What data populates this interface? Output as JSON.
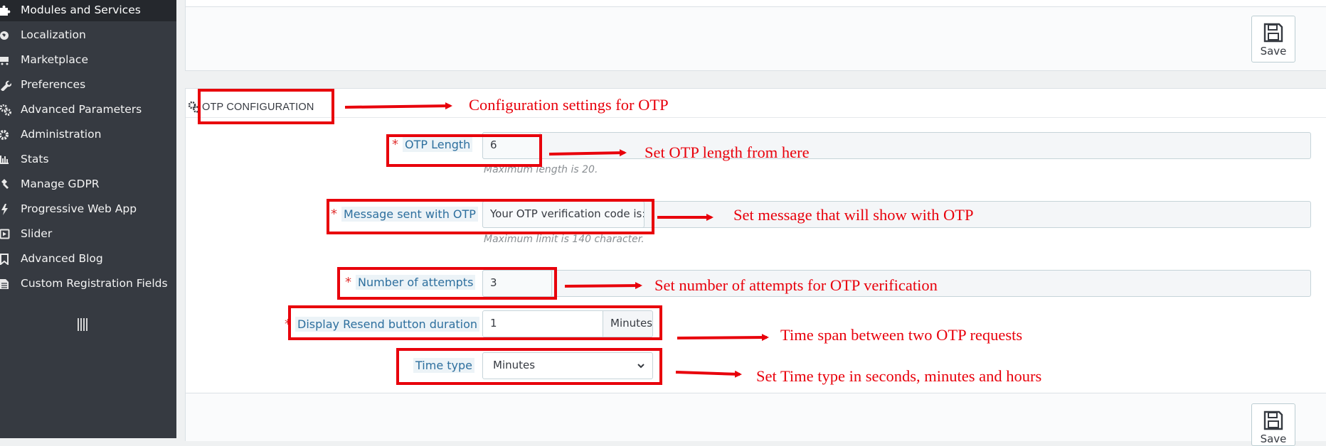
{
  "sidebar": {
    "items": [
      {
        "label": "Modules and Services",
        "icon": "puzzle-icon",
        "active": true
      },
      {
        "label": "Localization",
        "icon": "globe-icon"
      },
      {
        "label": "Marketplace",
        "icon": "cart-icon"
      },
      {
        "label": "Preferences",
        "icon": "wrench-icon"
      },
      {
        "label": "Advanced Parameters",
        "icon": "gears-icon"
      },
      {
        "label": "Administration",
        "icon": "gear-icon"
      },
      {
        "label": "Stats",
        "icon": "bar-chart-icon"
      },
      {
        "label": "Manage GDPR",
        "icon": "gavel-icon"
      },
      {
        "label": "Progressive Web App",
        "icon": "bolt-icon"
      },
      {
        "label": "Slider",
        "icon": "play-square-icon"
      },
      {
        "label": "Advanced Blog",
        "icon": "bookmark-icon"
      },
      {
        "label": "Custom Registration Fields",
        "icon": "file-icon"
      }
    ]
  },
  "toolbar": {
    "save_label": "Save"
  },
  "section": {
    "title": "OTP CONFIGURATION",
    "icon": "gears-icon"
  },
  "form": {
    "otp_length": {
      "label": "OTP Length",
      "value": "6",
      "help": "Maximum length is 20.",
      "required": true
    },
    "message": {
      "label": "Message sent with OTP",
      "value": "Your OTP verification code is:",
      "help": "Maximum limit is 140 character.",
      "required": true
    },
    "attempts": {
      "label": "Number of attempts",
      "value": "3",
      "required": true
    },
    "resend": {
      "label": "Display Resend button duration",
      "value": "1",
      "addon": "Minutes",
      "required": true
    },
    "time_type": {
      "label": "Time type",
      "selected": "Minutes"
    }
  },
  "annotations": {
    "config": "Configuration settings for OTP",
    "length": "Set OTP length from here",
    "message": "Set message that will show with OTP",
    "attempts": "Set number of attempts for OTP verification",
    "resend": "Time span between two OTP requests",
    "time_type": "Set Time type in seconds, minutes and hours"
  },
  "colors": {
    "annotation": "#e8000b",
    "sidebar_bg": "#363a41",
    "label": "#2d6f9e"
  }
}
